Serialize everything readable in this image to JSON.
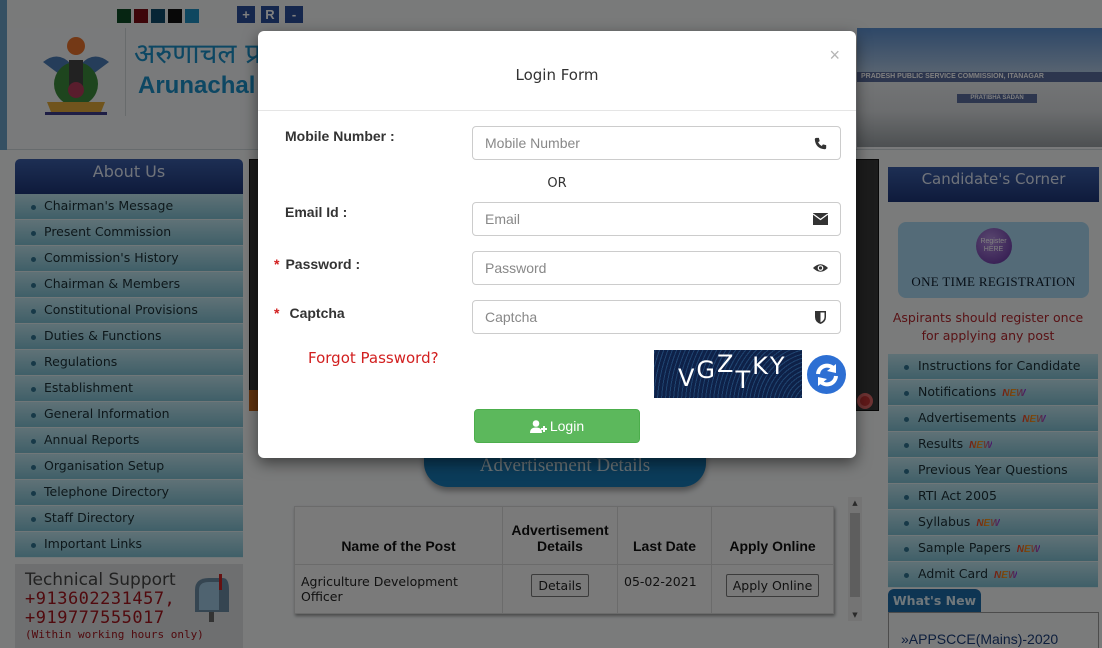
{
  "topbar": {
    "theme_colors": [
      "#0c4a24",
      "#7a0d14",
      "#0e4a6a",
      "#111111",
      "#1e8fc0"
    ],
    "font_buttons": [
      "+",
      "R",
      "-"
    ]
  },
  "header": {
    "title_hindi": "अरुणाचल प्रदेश लोक सेवा आयोग",
    "title_english": "Arunachal Pradesh Public Service Commission",
    "building_banner": "PRADESH PUBLIC SERVICE COMMISSION, ITANAGAR",
    "building_sub": "PRATIBHA SADAN"
  },
  "sidebar": {
    "heading": "About Us",
    "items": [
      {
        "label": "Chairman's Message"
      },
      {
        "label": "Present Commission"
      },
      {
        "label": "Commission's History"
      },
      {
        "label": "Chairman & Members"
      },
      {
        "label": "Constitutional Provisions"
      },
      {
        "label": "Duties & Functions"
      },
      {
        "label": "Regulations"
      },
      {
        "label": "Establishment"
      },
      {
        "label": "General Information"
      },
      {
        "label": "Annual Reports"
      },
      {
        "label": "Organisation Setup"
      },
      {
        "label": "Telephone Directory"
      },
      {
        "label": "Staff Directory"
      },
      {
        "label": "Important Links"
      }
    ]
  },
  "tech_support": {
    "title": "Technical Support",
    "phone1": "+913602231457,",
    "phone2": "+919777555017",
    "note": "(Within working hours only)"
  },
  "advertisement": {
    "heading": "Advertisement Details",
    "columns": [
      "Name of the Post",
      "Advertisement Details",
      "Last Date",
      "Apply Online"
    ],
    "rows": [
      {
        "post": "Agriculture Development Officer",
        "details_button": "Details",
        "last_date": "05-02-2021",
        "apply_button": "Apply Online"
      }
    ]
  },
  "candidates_corner": {
    "heading": "Candidate's Corner",
    "badge_text": "Register HERE",
    "otr_label": "ONE TIME REGISTRATION",
    "otr_note": "Aspirants should register once for applying any post",
    "items": [
      {
        "label": "Instructions for Candidate",
        "new": ""
      },
      {
        "label": "Notifications",
        "new": "NEW"
      },
      {
        "label": "Advertisements",
        "new": "NEW"
      },
      {
        "label": "Results",
        "new": "NEW"
      },
      {
        "label": "Previous Year Questions",
        "new": ""
      },
      {
        "label": "RTI Act 2005",
        "new": ""
      },
      {
        "label": "Syllabus",
        "new": "NEW"
      },
      {
        "label": "Sample Papers",
        "new": "NEW"
      },
      {
        "label": "Admit Card",
        "new": "NEW"
      }
    ],
    "whats_new_tab": "What's New",
    "whats_new_items": [
      "»APPSCCE(Mains)-2020"
    ]
  },
  "modal": {
    "title": "Login Form",
    "close_label": "×",
    "mobile": {
      "label": "Mobile Number :",
      "placeholder": "Mobile Number",
      "value": "",
      "icon": "phone-icon"
    },
    "or_label": "OR",
    "email": {
      "label": "Email Id :",
      "placeholder": "Email",
      "value": "",
      "icon": "envelope-icon"
    },
    "password": {
      "required_mark": "*",
      "label": "Password :",
      "placeholder": "Password",
      "value": "",
      "icon": "eye-icon"
    },
    "captcha": {
      "required_mark": "*",
      "label": "Captcha",
      "placeholder": "Captcha",
      "value": "",
      "icon": "shield-icon",
      "image_text": [
        "V",
        "G",
        "Z",
        "T",
        "K",
        "Y"
      ]
    },
    "forgot_label": "Forgot Password?",
    "login_label": "Login",
    "colors": {
      "login": "#5cb85c",
      "refresh": "#2d6fd3",
      "required": "#d21f1f"
    }
  }
}
